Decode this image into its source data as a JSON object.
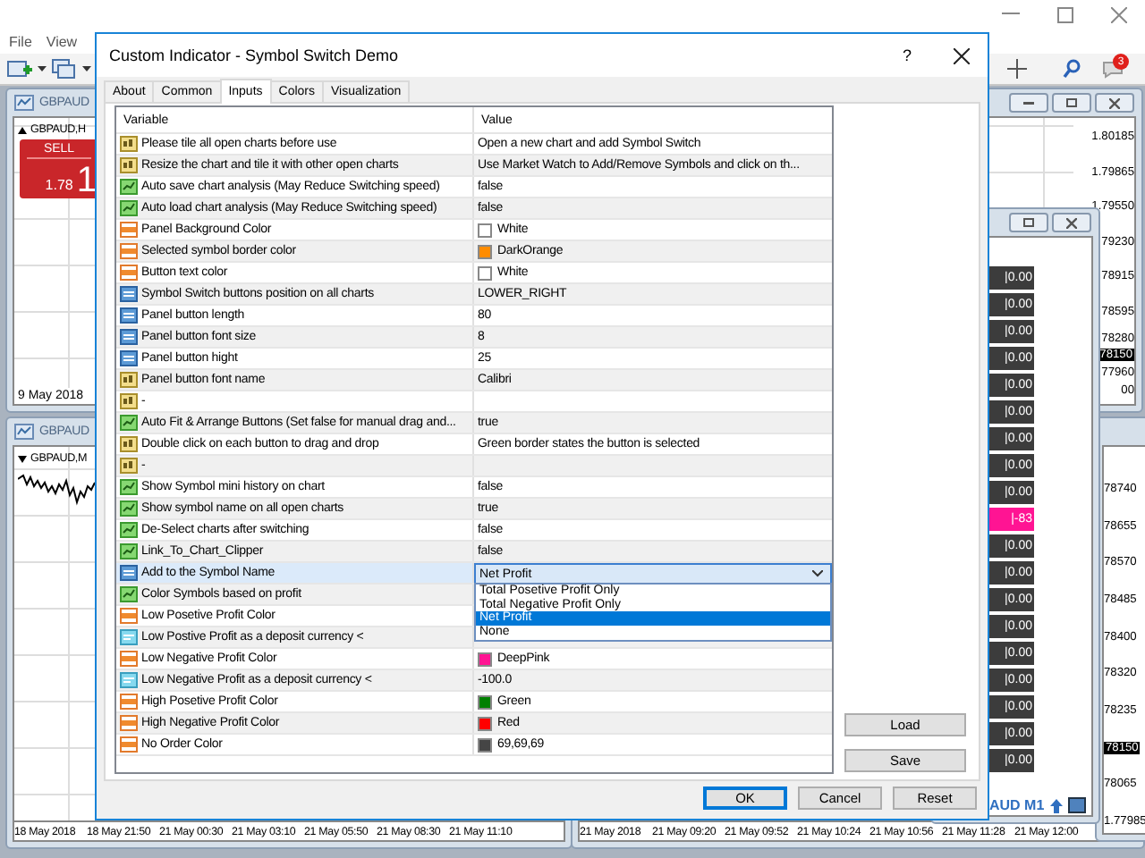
{
  "terminal": {
    "menu": [
      "File",
      "View"
    ],
    "notification_count": "3"
  },
  "charts": {
    "top_left": {
      "title": "GBPAUD",
      "symbol": "GBPAUD,H",
      "sell_label": "SELL",
      "price": "1.78",
      "price_big": "1",
      "date": "9 May 2018"
    },
    "bottom_left": {
      "title": "GBPAUD",
      "symbol": "GBPAUD,M",
      "time_axis": [
        "18 May 2018",
        "18 May 21:50",
        "21 May 00:30",
        "21 May 03:10",
        "21 May 05:50",
        "21 May 08:30",
        "21 May 11:10"
      ]
    },
    "bottom_right": {
      "time_axis": [
        "21 May 2018",
        "21 May 09:20",
        "21 May 09:52",
        "21 May 10:24",
        "21 May 10:56",
        "21 May 11:28",
        "21 May 12:00"
      ]
    },
    "top_right": {
      "price_axis": [
        {
          "text": "1.80185",
          "kind": "tick"
        },
        {
          "text": "1.79865",
          "kind": "tick"
        },
        {
          "text": "1.79550",
          "kind": "tick"
        },
        {
          "text": "79230",
          "kind": "tick"
        },
        {
          "text": "78915",
          "kind": "tick"
        },
        {
          "text": "78595",
          "kind": "tick"
        },
        {
          "text": "78280",
          "kind": "tick"
        },
        {
          "text": "78150",
          "kind": "current"
        },
        {
          "text": "77960",
          "kind": "tick"
        },
        {
          "text": "00",
          "kind": "tick"
        }
      ]
    },
    "right": {
      "price_axis": [
        {
          "text": "78740",
          "kind": "tick"
        },
        {
          "text": "78655",
          "kind": "tick"
        },
        {
          "text": "78570",
          "kind": "tick"
        },
        {
          "text": "78485",
          "kind": "tick"
        },
        {
          "text": "78400",
          "kind": "tick"
        },
        {
          "text": "78320",
          "kind": "tick"
        },
        {
          "text": "78235",
          "kind": "tick"
        },
        {
          "text": "78150",
          "kind": "current"
        },
        {
          "text": "78065",
          "kind": "tick"
        },
        {
          "text": "1.77985",
          "kind": "tick"
        }
      ]
    },
    "symbol_panel": {
      "label": "AUD M1",
      "buttons": [
        {
          "text": "|0.00",
          "color": "#3c3c3c"
        },
        {
          "text": "|0.00",
          "color": "#3c3c3c"
        },
        {
          "text": "|0.00",
          "color": "#3c3c3c"
        },
        {
          "text": "|0.00",
          "color": "#3c3c3c"
        },
        {
          "text": "|0.00",
          "color": "#3c3c3c"
        },
        {
          "text": "|0.00",
          "color": "#3c3c3c"
        },
        {
          "text": "|0.00",
          "color": "#3c3c3c"
        },
        {
          "text": "|0.00",
          "color": "#3c3c3c"
        },
        {
          "text": "|0.00",
          "color": "#3c3c3c"
        },
        {
          "text": "|-83",
          "color": "#ff1493"
        },
        {
          "text": "|0.00",
          "color": "#3c3c3c"
        },
        {
          "text": "|0.00",
          "color": "#3c3c3c"
        },
        {
          "text": "|0.00",
          "color": "#3c3c3c"
        },
        {
          "text": "|0.00",
          "color": "#3c3c3c"
        },
        {
          "text": "|0.00",
          "color": "#3c3c3c"
        },
        {
          "text": "|0.00",
          "color": "#3c3c3c"
        },
        {
          "text": "|0.00",
          "color": "#3c3c3c"
        },
        {
          "text": "|0.00",
          "color": "#3c3c3c"
        },
        {
          "text": "|0.00",
          "color": "#3c3c3c"
        }
      ]
    }
  },
  "dialog": {
    "title": "Custom Indicator - Symbol Switch Demo",
    "help": "?",
    "tabs": [
      {
        "label": "About",
        "selected": false
      },
      {
        "label": "Common",
        "selected": false
      },
      {
        "label": "Inputs",
        "selected": true
      },
      {
        "label": "Colors",
        "selected": false
      },
      {
        "label": "Visualization",
        "selected": false
      }
    ],
    "table": {
      "columns": [
        "Variable",
        "Value"
      ],
      "rows": [
        {
          "kind": "string",
          "name": "Please tile all open charts before use",
          "selected": false,
          "value": {
            "kind": "text",
            "text": "Open a new chart and add Symbol Switch"
          }
        },
        {
          "kind": "string",
          "name": "Resize the chart and tile it with other open charts",
          "selected": false,
          "value": {
            "kind": "text",
            "text": "Use Market Watch to Add/Remove Symbols and click on th..."
          }
        },
        {
          "kind": "bool",
          "name": "Auto save chart analysis (May Reduce Switching speed)",
          "selected": false,
          "value": {
            "kind": "text",
            "text": "false"
          }
        },
        {
          "kind": "bool",
          "name": "Auto load chart analysis (May Reduce Switching speed)",
          "selected": false,
          "value": {
            "kind": "text",
            "text": "false"
          }
        },
        {
          "kind": "color",
          "name": "Panel Background Color",
          "selected": false,
          "value": {
            "kind": "color",
            "color": "#ffffff",
            "text": "White"
          }
        },
        {
          "kind": "color",
          "name": "Selected symbol border color",
          "selected": false,
          "value": {
            "kind": "color",
            "color": "#ff8c00",
            "text": "DarkOrange"
          }
        },
        {
          "kind": "color",
          "name": "Button text color",
          "selected": false,
          "value": {
            "kind": "color",
            "color": "#ffffff",
            "text": "White"
          }
        },
        {
          "kind": "int",
          "name": "Symbol Switch buttons position on all charts",
          "selected": false,
          "value": {
            "kind": "text",
            "text": "LOWER_RIGHT"
          }
        },
        {
          "kind": "int",
          "name": "Panel button length",
          "selected": false,
          "value": {
            "kind": "text",
            "text": "80"
          }
        },
        {
          "kind": "int",
          "name": "Panel button font size",
          "selected": false,
          "value": {
            "kind": "text",
            "text": "8"
          }
        },
        {
          "kind": "int",
          "name": "Panel button hight",
          "selected": false,
          "value": {
            "kind": "text",
            "text": "25"
          }
        },
        {
          "kind": "string",
          "name": "Panel button font name",
          "selected": false,
          "value": {
            "kind": "text",
            "text": "Calibri"
          }
        },
        {
          "kind": "string",
          "name": "-",
          "selected": false
        },
        {
          "kind": "bool",
          "name": "Auto Fit & Arrange Buttons (Set false for manual drag and...",
          "selected": false,
          "value": {
            "kind": "text",
            "text": "true"
          }
        },
        {
          "kind": "string",
          "name": "Double click on each button to drag and drop",
          "selected": false,
          "value": {
            "kind": "text",
            "text": "Green border states the button is selected"
          }
        },
        {
          "kind": "string",
          "name": "-",
          "selected": false
        },
        {
          "kind": "bool",
          "name": "Show Symbol mini history on chart",
          "selected": false,
          "value": {
            "kind": "text",
            "text": "false"
          }
        },
        {
          "kind": "bool",
          "name": "Show symbol name on all open charts",
          "selected": false,
          "value": {
            "kind": "text",
            "text": "true"
          }
        },
        {
          "kind": "bool",
          "name": "De-Select charts after switching",
          "selected": false,
          "value": {
            "kind": "text",
            "text": "false"
          }
        },
        {
          "kind": "bool",
          "name": "Link_To_Chart_Clipper",
          "selected": false,
          "value": {
            "kind": "text",
            "text": "false"
          }
        },
        {
          "kind": "int",
          "name": "Add to the Symbol Name",
          "selected": true,
          "value": {
            "kind": "dropdown",
            "text": "Net Profit",
            "expanded": true,
            "options": [
              {
                "label": "Total Posetive Profit Only",
                "selected": false
              },
              {
                "label": "Total Negative Profit Only",
                "selected": false
              },
              {
                "label": "Net Profit",
                "selected": true
              },
              {
                "label": "None",
                "selected": false
              }
            ]
          }
        },
        {
          "kind": "bool",
          "name": "Color Symbols based on profit",
          "selected": false
        },
        {
          "kind": "color",
          "name": "Low Posetive Profit Color",
          "selected": false
        },
        {
          "kind": "double",
          "name": "Low Postive Profit as a deposit currency <",
          "selected": false
        },
        {
          "kind": "color",
          "name": "Low Negative Profit Color",
          "selected": false,
          "value": {
            "kind": "color",
            "color": "#ff1493",
            "text": "DeepPink"
          }
        },
        {
          "kind": "double",
          "name": "Low Negative Profit as a deposit currency <",
          "selected": false,
          "value": {
            "kind": "text",
            "text": "-100.0"
          }
        },
        {
          "kind": "color",
          "name": "High Posetive Profit Color",
          "selected": false,
          "value": {
            "kind": "color",
            "color": "#008000",
            "text": "Green"
          }
        },
        {
          "kind": "color",
          "name": "High Negative Profit Color",
          "selected": false,
          "value": {
            "kind": "color",
            "color": "#ff0000",
            "text": "Red"
          }
        },
        {
          "kind": "color",
          "name": "No Order Color",
          "selected": false,
          "value": {
            "kind": "color",
            "color": "#454545",
            "text": "69,69,69"
          }
        }
      ]
    },
    "side_buttons": [
      "Load",
      "Save"
    ],
    "buttons": [
      {
        "label": "OK",
        "default": true
      },
      {
        "label": "Cancel",
        "default": false
      },
      {
        "label": "Reset",
        "default": false
      }
    ]
  }
}
